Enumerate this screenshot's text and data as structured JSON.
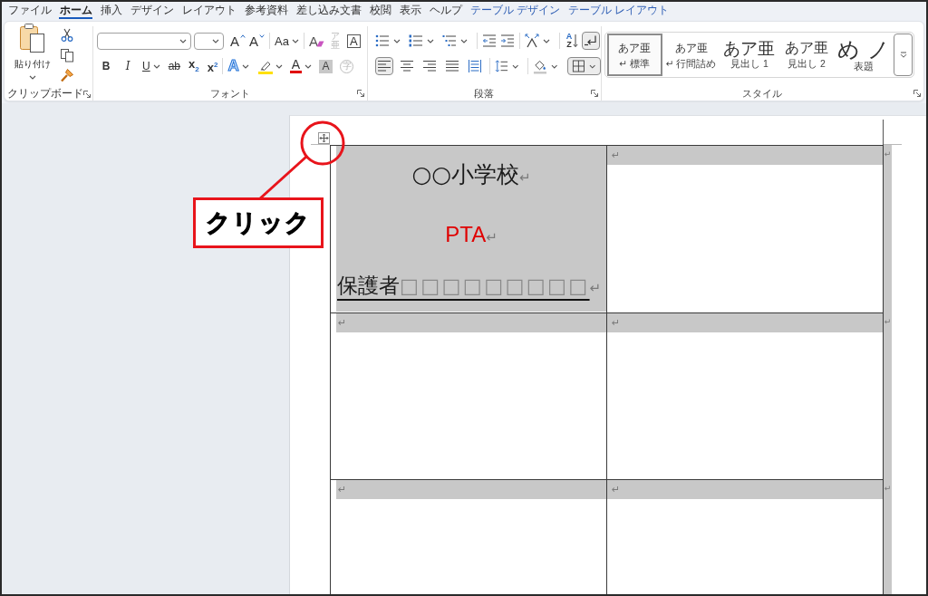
{
  "tabs": [
    {
      "label": "ファイル",
      "selected": false,
      "contextual": false
    },
    {
      "label": "ホーム",
      "selected": true,
      "contextual": false
    },
    {
      "label": "挿入",
      "selected": false,
      "contextual": false
    },
    {
      "label": "デザイン",
      "selected": false,
      "contextual": false
    },
    {
      "label": "レイアウト",
      "selected": false,
      "contextual": false
    },
    {
      "label": "参考資料",
      "selected": false,
      "contextual": false
    },
    {
      "label": "差し込み文書",
      "selected": false,
      "contextual": false
    },
    {
      "label": "校閲",
      "selected": false,
      "contextual": false
    },
    {
      "label": "表示",
      "selected": false,
      "contextual": false
    },
    {
      "label": "ヘルプ",
      "selected": false,
      "contextual": false
    },
    {
      "label": "テーブル デザイン",
      "selected": false,
      "contextual": true
    },
    {
      "label": "テーブル レイアウト",
      "selected": false,
      "contextual": true
    }
  ],
  "clipboard": {
    "paste_label": "貼り付け",
    "group_label": "クリップボード"
  },
  "font": {
    "grow_font": "A",
    "shrink_font": "A",
    "change_case": "Aa",
    "clear_formatting": "A",
    "phonetic_guide": {
      "ruby": "ア",
      "base": "亜",
      "disabled": true
    },
    "char_border": "A",
    "bold": "B",
    "italic": "I",
    "underline": "U",
    "strikethrough": "ab",
    "subscript": "x$_{2}$",
    "superscript": "x$^{2}$",
    "text_effect": "A",
    "font_color": "A",
    "char_shading": "A",
    "enclose_char": {
      "text": "字",
      "disabled": true
    },
    "group_label": "フォント"
  },
  "paragraph": {
    "sort": {
      "top": "A",
      "bottom": "Z"
    },
    "show_marks": {
      "on": true
    },
    "alignments": [
      {
        "selected": true
      },
      {
        "selected": false
      },
      {
        "selected": false
      },
      {
        "selected": false
      },
      {
        "selected": false
      }
    ],
    "borders": {
      "on": true
    },
    "group_label": "段落"
  },
  "styles": {
    "items": [
      {
        "kind": "body",
        "sample": "あア亜",
        "label": "↵ 標準",
        "selected": true
      },
      {
        "kind": "body",
        "sample": "あア亜",
        "label": "↵ 行間詰め",
        "selected": false
      },
      {
        "kind": "heading1",
        "sample": "あア亜",
        "label": "見出し 1",
        "selected": false
      },
      {
        "kind": "heading2",
        "sample": "あア亜",
        "label": "見出し 2",
        "selected": false
      },
      {
        "kind": "title",
        "sample": "め ノ",
        "label": "表題",
        "selected": false
      }
    ],
    "group_label": "スタイル"
  },
  "document": {
    "table": {
      "rows": [
        {
          "cells": [
            {
              "selected": true,
              "paragraphs": [
                {
                  "kind": "heading",
                  "text": "○○小学校",
                  "mark": "↵",
                  "color": "#1a1a1a"
                },
                {
                  "kind": "accent",
                  "text": "PTA",
                  "mark": "↵",
                  "color": "#e00000"
                },
                {
                  "kind": "fill",
                  "text": "保護者",
                  "blanks": "□□□□□□□□□",
                  "mark": "↵",
                  "color": "#1a1a1a"
                }
              ]
            },
            {
              "selected": true,
              "paragraphs": [
                {
                  "kind": "empty",
                  "mark": "↵"
                }
              ]
            }
          ],
          "end": {
            "mark": "↵",
            "selected": true
          }
        },
        {
          "cells": [
            {
              "selected": true,
              "paragraphs": [
                {
                  "kind": "empty",
                  "mark": "↵"
                }
              ]
            },
            {
              "selected": true,
              "paragraphs": [
                {
                  "kind": "empty",
                  "mark": "↵"
                }
              ]
            }
          ],
          "end": {
            "mark": "↵",
            "selected": true
          }
        },
        {
          "cells": [
            {
              "selected": true,
              "paragraphs": [
                {
                  "kind": "empty",
                  "mark": "↵"
                }
              ]
            },
            {
              "selected": true,
              "paragraphs": [
                {
                  "kind": "empty",
                  "mark": "↵"
                }
              ]
            }
          ],
          "end": {
            "mark": "↵",
            "selected": true
          }
        }
      ]
    }
  },
  "callout": {
    "text": "クリック"
  }
}
